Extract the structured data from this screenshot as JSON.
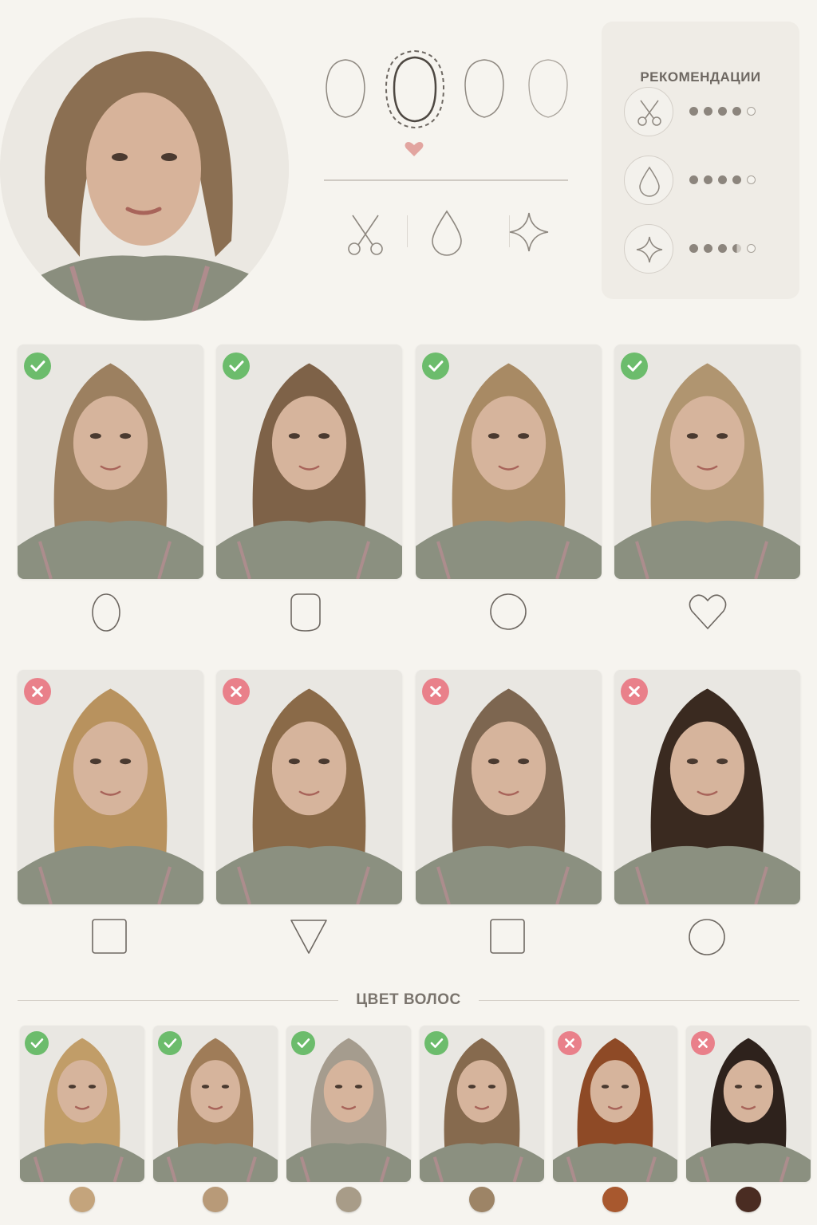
{
  "profile": {
    "alt": "Портрет пользователя"
  },
  "recommendations": {
    "title": "РЕКОМЕНДАЦИИ",
    "rows": [
      {
        "icon": "scissors-icon",
        "rating": 4,
        "max": 5
      },
      {
        "icon": "water-drop-icon",
        "rating": 4,
        "max": 5
      },
      {
        "icon": "sparkle-icon",
        "rating": 3.5,
        "max": 5
      }
    ]
  },
  "face_shapes": [
    "oval",
    "oblong",
    "oval",
    "oval"
  ],
  "selected_face_shape_index": 1,
  "tools": [
    "scissors-icon",
    "water-drop-icon",
    "sparkle-icon"
  ],
  "styles_recommended": [
    {
      "status": "check-icon",
      "hair": "#9c8060",
      "shape": "oval"
    },
    {
      "status": "check-icon",
      "hair": "#7e6248",
      "shape": "rounded-square"
    },
    {
      "status": "check-icon",
      "hair": "#a88a64",
      "shape": "circle"
    },
    {
      "status": "check-icon",
      "hair": "#b09570",
      "shape": "heart"
    }
  ],
  "styles_avoid": [
    {
      "status": "cross-icon",
      "hair": "#b8925e",
      "shape": "square"
    },
    {
      "status": "cross-icon",
      "hair": "#8a6a48",
      "shape": "triangle"
    },
    {
      "status": "cross-icon",
      "hair": "#7d6650",
      "shape": "square"
    },
    {
      "status": "cross-icon",
      "hair": "#3a2a20",
      "shape": "circle"
    }
  ],
  "hair_color": {
    "title": "ЦВЕТ ВОЛОС",
    "items": [
      {
        "status": "check-icon",
        "hair": "#c19d68",
        "swatch": "#c4a47c"
      },
      {
        "status": "check-icon",
        "hair": "#9f7c58",
        "swatch": "#b89a78"
      },
      {
        "status": "check-icon",
        "hair": "#a59c8e",
        "swatch": "#a89c88"
      },
      {
        "status": "check-icon",
        "hair": "#866a4e",
        "swatch": "#9d8466"
      },
      {
        "status": "cross-icon",
        "hair": "#8e4a26",
        "swatch": "#a8582e"
      },
      {
        "status": "cross-icon",
        "hair": "#2e221c",
        "swatch": "#4a2c22"
      }
    ]
  },
  "colors": {
    "ok": "#6cbc6c",
    "no": "#e9808a",
    "accent_heart": "#e2a5a0",
    "line": "#8e8880"
  }
}
